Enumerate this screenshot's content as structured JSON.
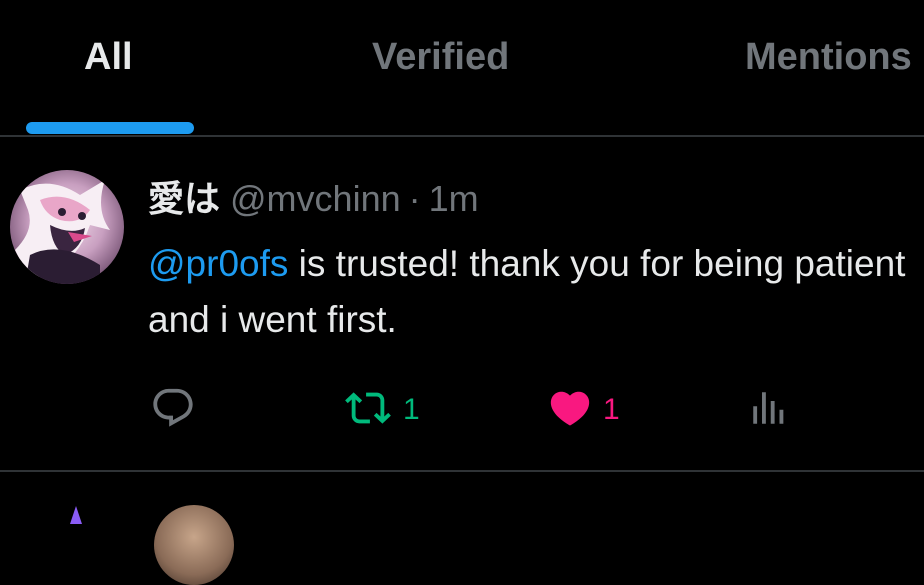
{
  "tabs": [
    {
      "label": "All",
      "active": true
    },
    {
      "label": "Verified",
      "active": false
    },
    {
      "label": "Mentions",
      "active": false
    }
  ],
  "tweet": {
    "display_name": "愛は",
    "handle": "@mvchinn",
    "separator": "·",
    "time": "1m",
    "mention": "@pr0ofs",
    "text": " is trusted! thank you for being patient and i went first.",
    "actions": {
      "reply": {
        "icon": "reply-icon"
      },
      "retweet": {
        "icon": "retweet-icon",
        "count": "1"
      },
      "like": {
        "icon": "heart-icon",
        "count": "1",
        "liked": true
      },
      "views": {
        "icon": "views-icon"
      }
    }
  },
  "colors": {
    "background": "#000000",
    "accent": "#1d9bf0",
    "text_primary": "#e7e9ea",
    "text_secondary": "#71767b",
    "retweet": "#00ba7c",
    "like": "#f91880",
    "divider": "#2f3336"
  }
}
